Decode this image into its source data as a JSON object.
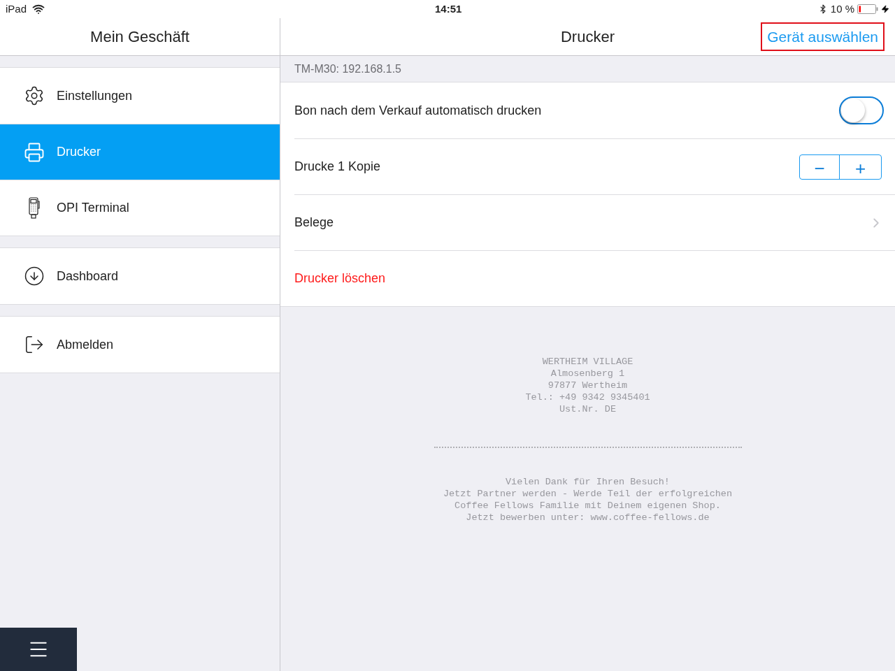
{
  "status_bar": {
    "device": "iPad",
    "time": "14:51",
    "battery": "10 %"
  },
  "sidebar": {
    "title": "Mein Geschäft",
    "groups": [
      {
        "items": [
          {
            "label": "Einstellungen",
            "kind": "settings",
            "selected": false
          },
          {
            "label": "Drucker",
            "kind": "printer",
            "selected": true
          },
          {
            "label": "OPI Terminal",
            "kind": "terminal",
            "selected": false
          }
        ]
      },
      {
        "items": [
          {
            "label": "Dashboard",
            "kind": "download",
            "selected": false
          }
        ]
      },
      {
        "items": [
          {
            "label": "Abmelden",
            "kind": "logout",
            "selected": false
          }
        ]
      }
    ]
  },
  "main": {
    "title": "Drucker",
    "action": {
      "label": "Gerät auswählen",
      "highlighted": true
    },
    "section_header": "TM-M30: 192.168.1.5",
    "rows": [
      {
        "kind": "toggle",
        "label": "Bon nach dem Verkauf automatisch drucken",
        "on": false
      },
      {
        "kind": "stepper",
        "label": "Drucke 1 Kopie",
        "minus": "−",
        "plus": "+"
      },
      {
        "kind": "link",
        "label": "Belege"
      },
      {
        "kind": "destructive",
        "label": "Drucker löschen"
      }
    ],
    "receipt": {
      "header_lines": [
        "WERTHEIM VILLAGE",
        "Almosenberg 1",
        "97877 Wertheim",
        "Tel.: +49 9342 9345401",
        "Ust.Nr. DE"
      ],
      "footer_lines": [
        "Vielen Dank für Ihren Besuch!",
        "Jetzt Partner werden - Werde Teil der erfolgreichen",
        "Coffee Fellows Familie mit Deinem eigenen Shop.",
        "Jetzt bewerben unter: www.coffee-fellows.de"
      ]
    }
  }
}
